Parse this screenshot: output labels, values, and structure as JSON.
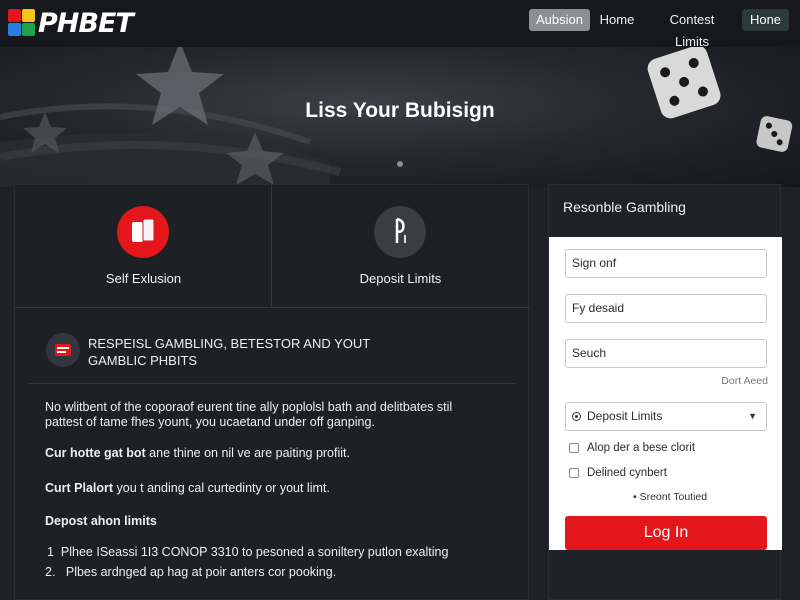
{
  "header": {
    "logo_text": "PHBET",
    "nav": [
      "Aubsion",
      "Home",
      "Contest Limits",
      "Hone"
    ]
  },
  "hero": {
    "title": "Liss Your Bubisign"
  },
  "features": [
    {
      "label": "Self Exlusion",
      "icon": "self-exclusion-icon"
    },
    {
      "label": "Deposit Limits",
      "icon": "deposit-limits-icon"
    }
  ],
  "section": {
    "heading_line1": "RESPEISL GAMBLING, BETESTOR AND YOUT",
    "heading_line2": "GAMBLIC PHBITS",
    "para1_line1": "No wlitbent of the coporaof eurent tine ally poplolsl bath and delitbates stil",
    "para1_line2": "pattest of tame fhes yount, you ucaetand under off ganping.",
    "para2_bold": "Cur hotte gat bot",
    "para2_rest": " ane thine on nil ve are paiting profiit.",
    "para3_bold": "Curt Plalort",
    "para3_rest": " you t anding cal curtedinty or yout limt.",
    "list_heading": "Depost ahon limits",
    "list": [
      {
        "num": "1",
        "text": "Plhee ISeassi 1I3 CONOP 3310 to pesoned a soniltery putlon exalting"
      },
      {
        "num": "2.",
        "text": "Plbes ardnged ap hag at poir anters cor pooking."
      }
    ]
  },
  "sidebar": {
    "title": "Resonble Gambling",
    "fields": {
      "sign_on": "Sign onf",
      "by_deposit": "Fy desaid",
      "search": "Seuch"
    },
    "dont_read": "Dort Aeed",
    "select_value": "Deposit Limits",
    "checks": [
      "Alop der a bese clorit",
      "Delined cynbert"
    ],
    "small_link": "Sreont Toutied",
    "login_label": "Log In"
  },
  "colors": {
    "accent_red": "#e3161b",
    "background": "#1e2126",
    "header": "#16181d"
  }
}
